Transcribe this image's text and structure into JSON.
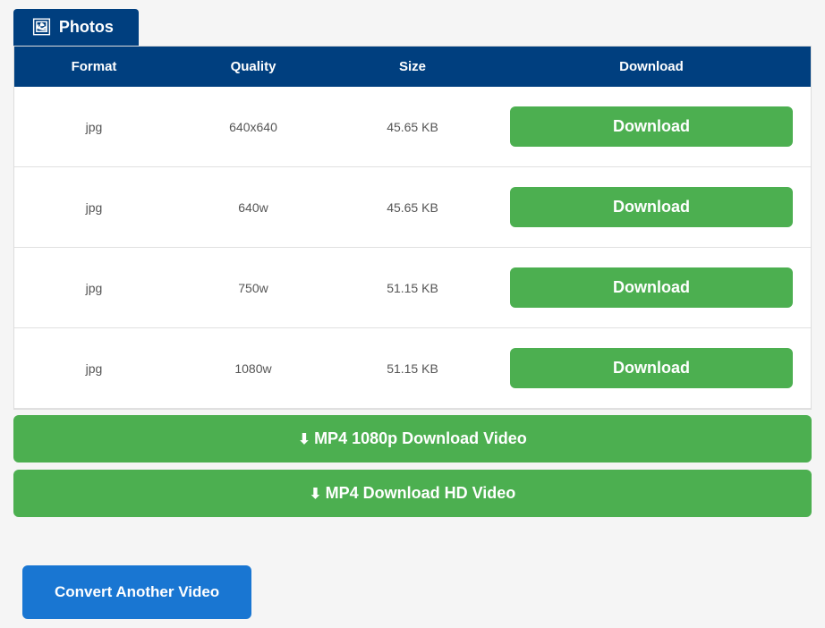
{
  "tab": {
    "icon": "🖼",
    "label": "Photos"
  },
  "table": {
    "headers": [
      "Format",
      "Quality",
      "Size",
      "Download"
    ],
    "rows": [
      {
        "format": "jpg",
        "quality": "640x640",
        "size": "45.65 KB"
      },
      {
        "format": "jpg",
        "quality": "640w",
        "size": "45.65 KB"
      },
      {
        "format": "jpg",
        "quality": "750w",
        "size": "51.15 KB"
      },
      {
        "format": "jpg",
        "quality": "1080w",
        "size": "51.15 KB"
      }
    ],
    "download_label": "Download"
  },
  "video_buttons": [
    {
      "label": "MP4 1080p Download Video"
    },
    {
      "label": "MP4 Download HD Video"
    }
  ],
  "convert_button": {
    "label": "Convert Another Video"
  }
}
